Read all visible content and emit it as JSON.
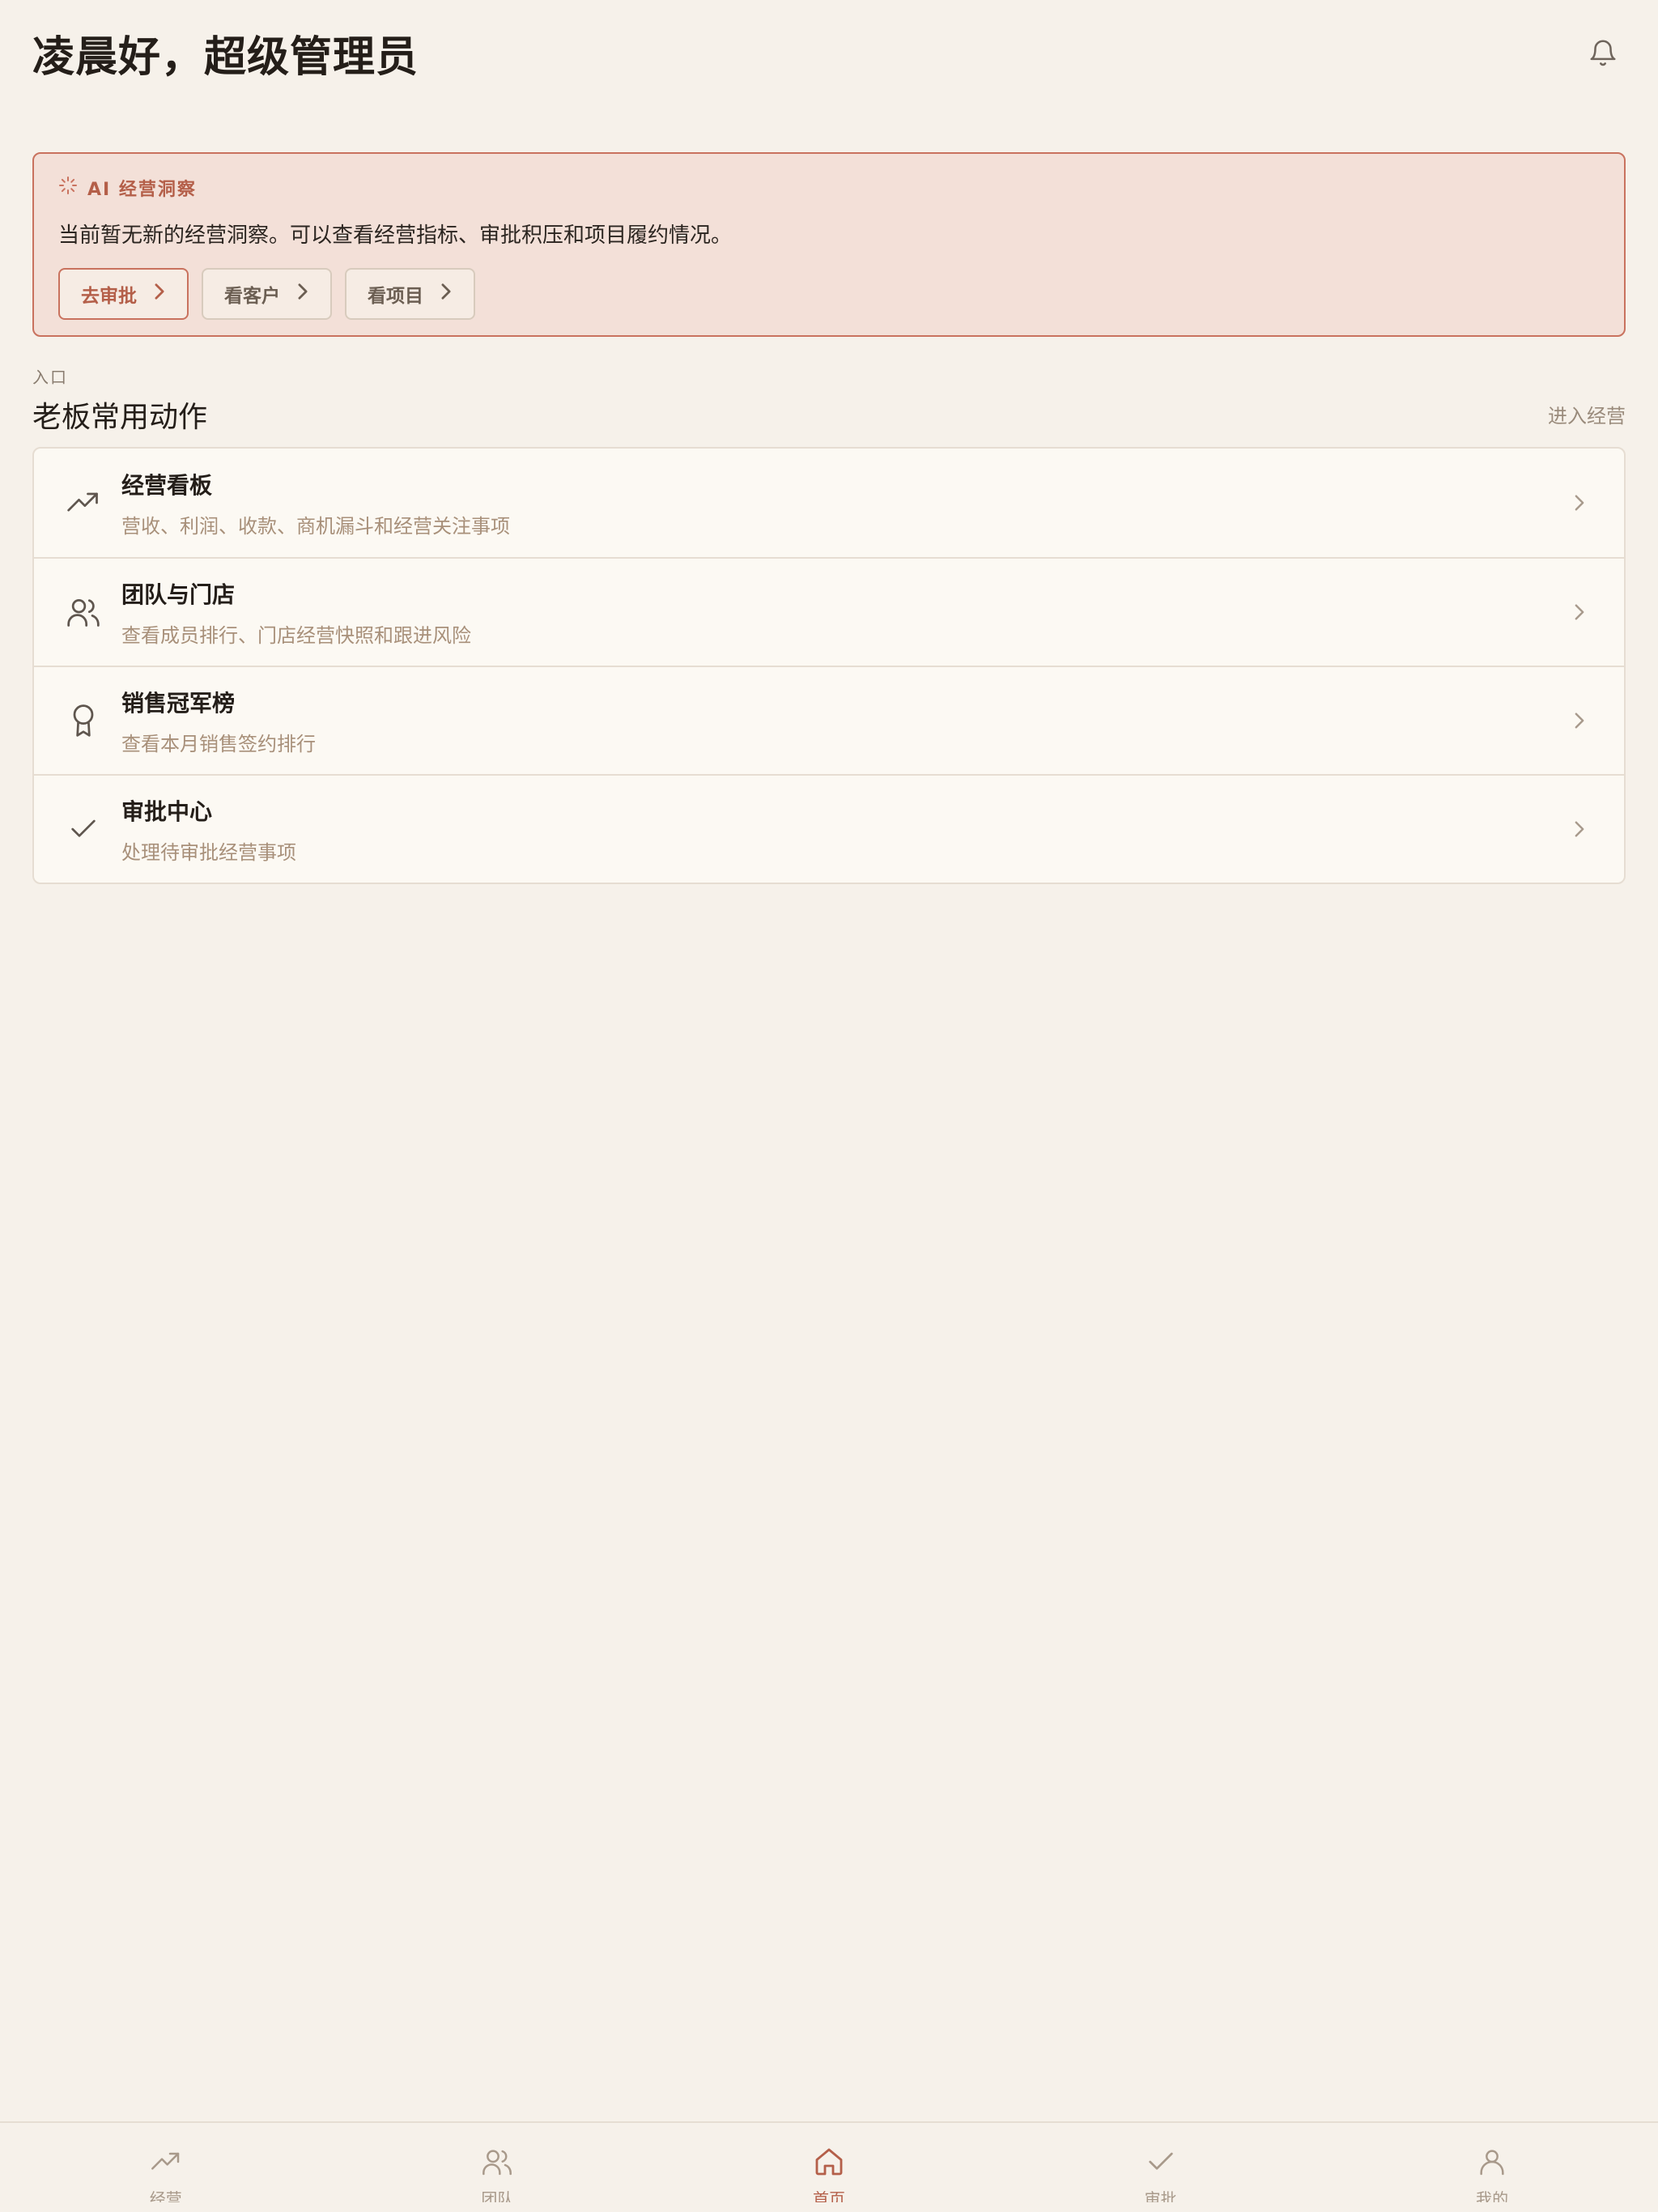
{
  "header": {
    "greeting": "凌晨好，超级管理员",
    "bell_icon": "bell-icon"
  },
  "ai_insight": {
    "title": "AI 经营洞察",
    "message": "当前暂无新的经营洞察。可以查看经营指标、审批积压和项目履约情况。",
    "actions": [
      {
        "label": "去审批",
        "primary": true
      },
      {
        "label": "看客户",
        "primary": false
      },
      {
        "label": "看项目",
        "primary": false
      }
    ]
  },
  "section": {
    "eyebrow": "入口",
    "title": "老板常用动作",
    "link": "进入经营"
  },
  "actions": [
    {
      "icon": "trending-up-icon",
      "title": "经营看板",
      "subtitle": "营收、利润、收款、商机漏斗和经营关注事项"
    },
    {
      "icon": "users-icon",
      "title": "团队与门店",
      "subtitle": "查看成员排行、门店经营快照和跟进风险"
    },
    {
      "icon": "award-icon",
      "title": "销售冠军榜",
      "subtitle": "查看本月销售签约排行"
    },
    {
      "icon": "check-icon",
      "title": "审批中心",
      "subtitle": "处理待审批经营事项"
    }
  ],
  "tabbar": {
    "items": [
      {
        "icon": "trending-up-icon",
        "label": "经营",
        "active": false
      },
      {
        "icon": "users-icon",
        "label": "团队",
        "active": false
      },
      {
        "icon": "home-icon",
        "label": "首页",
        "active": true
      },
      {
        "icon": "check-icon",
        "label": "审批",
        "active": false
      },
      {
        "icon": "user-icon",
        "label": "我的",
        "active": false
      }
    ]
  },
  "colors": {
    "background": "#f6f1ea",
    "accent": "#b45f49",
    "card_bg": "#f3e0d8",
    "muted_text": "#a8907a"
  }
}
